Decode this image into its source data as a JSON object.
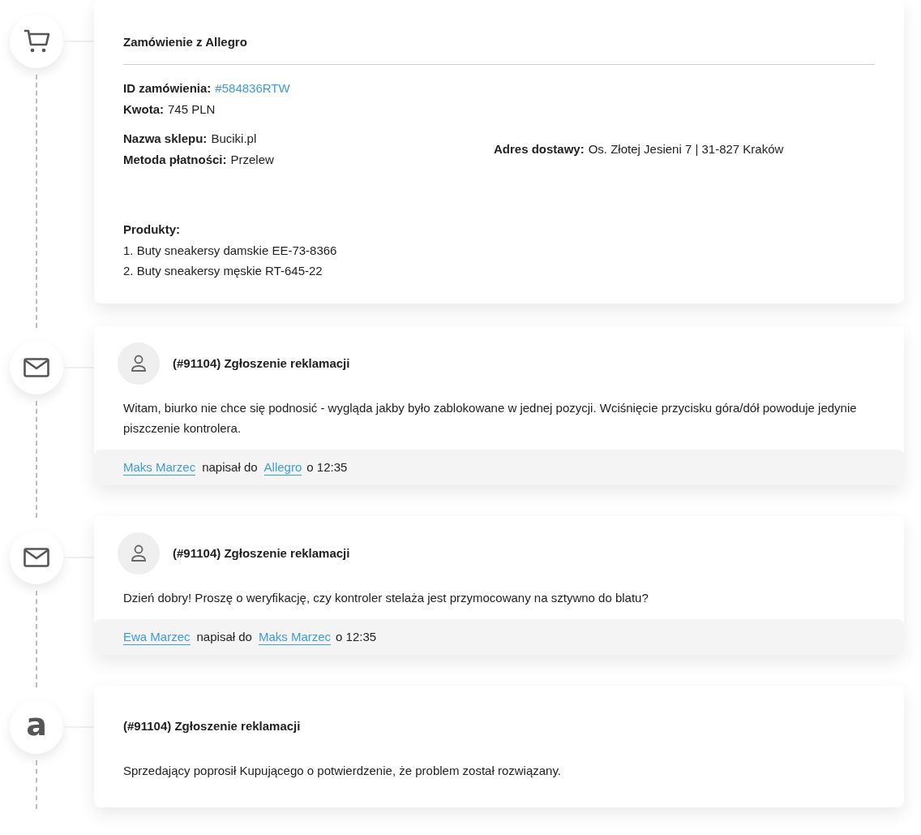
{
  "events": [
    {
      "kind": "order",
      "title": "Zamówienie z Allegro",
      "order_id": {
        "label": "ID zamówienia:",
        "value": "#584836RTW"
      },
      "amount": {
        "label": "Kwota:",
        "value": "745 PLN"
      },
      "shop": {
        "label": "Nazwa sklepu:",
        "value": "Buciki.pl"
      },
      "payment": {
        "label": "Metoda płatności:",
        "value": "Przelew"
      },
      "address": {
        "label": "Adres dostawy:",
        "value": "Os. Złotej Jesieni 7 | 31-827 Kraków"
      },
      "products": {
        "label": "Produkty:",
        "items": [
          "1. Buty sneakersy damskie EE-73-8366",
          "2. Buty sneakersy męskie RT-645-22"
        ]
      }
    },
    {
      "kind": "message",
      "title": "(#91104) Zgłoszenie reklamacji",
      "body": "Witam, biurko nie chce się podnosić - wygląda jakby było zablokowane w jednej pozycji. Wciśnięcie przycisku góra/dół powoduje jedynie piszczenie kontrolera.",
      "footer": {
        "author": "Maks Marzec",
        "verb": "napisał do",
        "recipient": "Allegro",
        "time": "o 12:35"
      }
    },
    {
      "kind": "message",
      "title": "(#91104) Zgłoszenie reklamacji",
      "body": "Dzień dobry! Proszę o weryfikację, czy kontroler stelaża jest przymocowany na sztywno do blatu?",
      "footer": {
        "author": "Ewa Marzec",
        "verb": "napisał do",
        "recipient": "Maks Marzec",
        "time": "o 12:35"
      }
    },
    {
      "kind": "system",
      "logo_letter": "a",
      "title": "(#91104) Zgłoszenie reklamacji",
      "body": "Sprzedający poprosił Kupującego o potwierdzenie, że problem został rozwiązany."
    }
  ]
}
